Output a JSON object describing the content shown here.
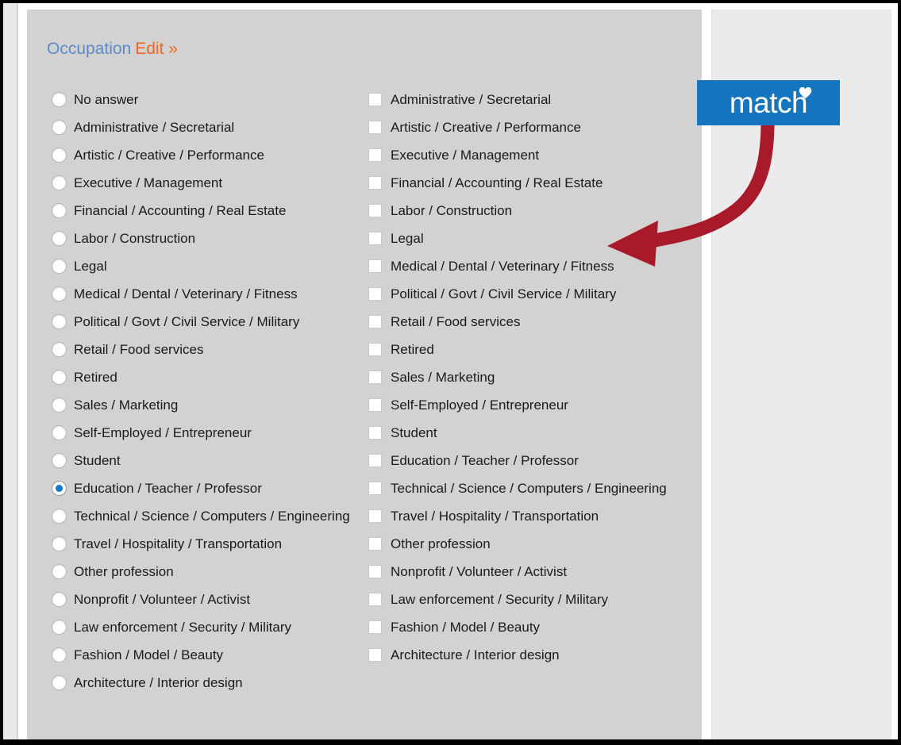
{
  "heading": {
    "title": "Occupation",
    "edit_label": "Edit »"
  },
  "radio_group": {
    "name": "occupation-single-select",
    "selected": "Education / Teacher / Professor",
    "options": [
      {
        "label": "No answer",
        "checked": false
      },
      {
        "label": "Administrative / Secretarial",
        "checked": false
      },
      {
        "label": "Artistic / Creative / Performance",
        "checked": false
      },
      {
        "label": "Executive / Management",
        "checked": false
      },
      {
        "label": "Financial / Accounting / Real Estate",
        "checked": false
      },
      {
        "label": "Labor / Construction",
        "checked": false
      },
      {
        "label": "Legal",
        "checked": false
      },
      {
        "label": "Medical / Dental / Veterinary / Fitness",
        "checked": false
      },
      {
        "label": "Political / Govt / Civil Service / Military",
        "checked": false
      },
      {
        "label": "Retail / Food services",
        "checked": false
      },
      {
        "label": "Retired",
        "checked": false
      },
      {
        "label": "Sales / Marketing",
        "checked": false
      },
      {
        "label": "Self-Employed / Entrepreneur",
        "checked": false
      },
      {
        "label": "Student",
        "checked": false
      },
      {
        "label": "Education / Teacher / Professor",
        "checked": true
      },
      {
        "label": "Technical / Science / Computers / Engineering",
        "checked": false
      },
      {
        "label": "Travel / Hospitality / Transportation",
        "checked": false
      },
      {
        "label": "Other profession",
        "checked": false
      },
      {
        "label": "Nonprofit / Volunteer / Activist",
        "checked": false
      },
      {
        "label": "Law enforcement / Security / Military",
        "checked": false
      },
      {
        "label": "Fashion / Model / Beauty",
        "checked": false
      },
      {
        "label": "Architecture / Interior design",
        "checked": false
      }
    ]
  },
  "checkbox_group": {
    "name": "occupation-multi-select",
    "options": [
      {
        "label": "Administrative / Secretarial",
        "checked": false
      },
      {
        "label": "Artistic / Creative / Performance",
        "checked": false
      },
      {
        "label": "Executive / Management",
        "checked": false
      },
      {
        "label": "Financial / Accounting / Real Estate",
        "checked": false
      },
      {
        "label": "Labor / Construction",
        "checked": false
      },
      {
        "label": "Legal",
        "checked": false
      },
      {
        "label": "Medical / Dental / Veterinary / Fitness",
        "checked": false
      },
      {
        "label": "Political / Govt / Civil Service / Military",
        "checked": false
      },
      {
        "label": "Retail / Food services",
        "checked": false
      },
      {
        "label": "Retired",
        "checked": false
      },
      {
        "label": "Sales / Marketing",
        "checked": false
      },
      {
        "label": "Self-Employed / Entrepreneur",
        "checked": false
      },
      {
        "label": "Student",
        "checked": false
      },
      {
        "label": "Education / Teacher / Professor",
        "checked": false
      },
      {
        "label": "Technical / Science / Computers / Engineering",
        "checked": false
      },
      {
        "label": "Travel / Hospitality / Transportation",
        "checked": false
      },
      {
        "label": "Other profession",
        "checked": false
      },
      {
        "label": "Nonprofit / Volunteer / Activist",
        "checked": false
      },
      {
        "label": "Law enforcement / Security / Military",
        "checked": false
      },
      {
        "label": "Fashion / Model / Beauty",
        "checked": false
      },
      {
        "label": "Architecture / Interior design",
        "checked": false
      }
    ]
  },
  "logo": {
    "wordmark": "match",
    "icon": "heart-icon"
  },
  "annotation": {
    "arrow": "curved-arrow-icon",
    "direction": "left"
  },
  "colors": {
    "heading_blue": "#5b8ac6",
    "edit_orange": "#f26522",
    "logo_blue": "#1576bf",
    "arrow_red": "#a8192a",
    "selected_radio_blue": "#1478c8",
    "card_gray": "#d2d2d2",
    "side_panel_gray": "#ebebeb",
    "frame_black": "#000000"
  }
}
